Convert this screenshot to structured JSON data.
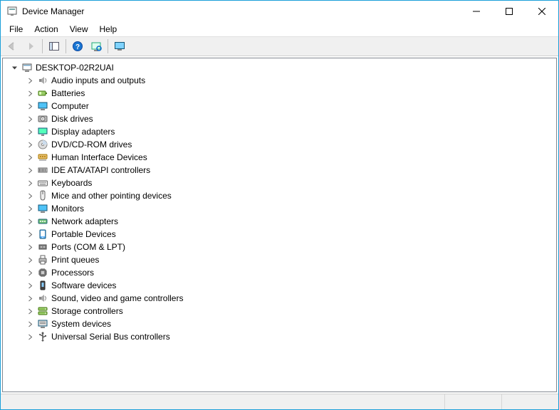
{
  "window": {
    "title": "Device Manager"
  },
  "menu": {
    "items": [
      "File",
      "Action",
      "View",
      "Help"
    ]
  },
  "toolbar": {
    "back": "Back",
    "forward": "Forward",
    "show_hide": "Show/Hide Console Tree",
    "help": "Help",
    "scan": "Scan for hardware changes",
    "monitor": "View"
  },
  "tree": {
    "root": {
      "label": "DESKTOP-02R2UAI",
      "expanded": true
    },
    "children": [
      {
        "label": "Audio inputs and outputs",
        "icon": "audio"
      },
      {
        "label": "Batteries",
        "icon": "battery"
      },
      {
        "label": "Computer",
        "icon": "computer"
      },
      {
        "label": "Disk drives",
        "icon": "disk"
      },
      {
        "label": "Display adapters",
        "icon": "display"
      },
      {
        "label": "DVD/CD-ROM drives",
        "icon": "dvd"
      },
      {
        "label": "Human Interface Devices",
        "icon": "hid"
      },
      {
        "label": "IDE ATA/ATAPI controllers",
        "icon": "ide"
      },
      {
        "label": "Keyboards",
        "icon": "keyboard"
      },
      {
        "label": "Mice and other pointing devices",
        "icon": "mouse"
      },
      {
        "label": "Monitors",
        "icon": "monitor"
      },
      {
        "label": "Network adapters",
        "icon": "network"
      },
      {
        "label": "Portable Devices",
        "icon": "portable"
      },
      {
        "label": "Ports (COM & LPT)",
        "icon": "port"
      },
      {
        "label": "Print queues",
        "icon": "printer"
      },
      {
        "label": "Processors",
        "icon": "cpu"
      },
      {
        "label": "Software devices",
        "icon": "software"
      },
      {
        "label": "Sound, video and game controllers",
        "icon": "sound"
      },
      {
        "label": "Storage controllers",
        "icon": "storage"
      },
      {
        "label": "System devices",
        "icon": "system"
      },
      {
        "label": "Universal Serial Bus controllers",
        "icon": "usb"
      }
    ]
  }
}
